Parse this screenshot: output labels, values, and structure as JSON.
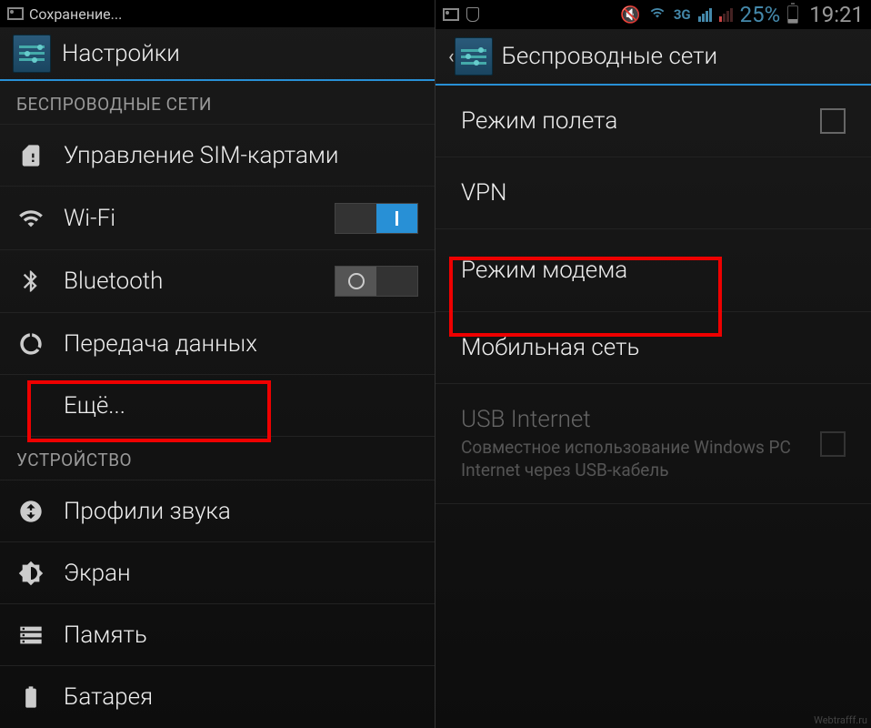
{
  "status_left": {
    "saving_text": "Сохранение..."
  },
  "status_right": {
    "network_label": "3G",
    "battery_pct": "25%",
    "time": "19:21"
  },
  "left_pane": {
    "title": "Настройки",
    "section_wireless": "БЕСПРОВОДНЫЕ СЕТИ",
    "sim": "Управление SIM-картами",
    "wifi": "Wi-Fi",
    "bluetooth": "Bluetooth",
    "data": "Передача данных",
    "more": "Ещё...",
    "section_device": "УСТРОЙСТВО",
    "sound": "Профили звука",
    "display": "Экран",
    "storage": "Память",
    "battery": "Батарея"
  },
  "right_pane": {
    "title": "Беспроводные сети",
    "airplane": "Режим полета",
    "vpn": "VPN",
    "tethering": "Режим модема",
    "mobile": "Мобильная сеть",
    "usb_title": "USB Internet",
    "usb_sub": "Совместное использование Windows PC Internet через USB-кабель"
  },
  "watermark": "Webtrafff.ru"
}
